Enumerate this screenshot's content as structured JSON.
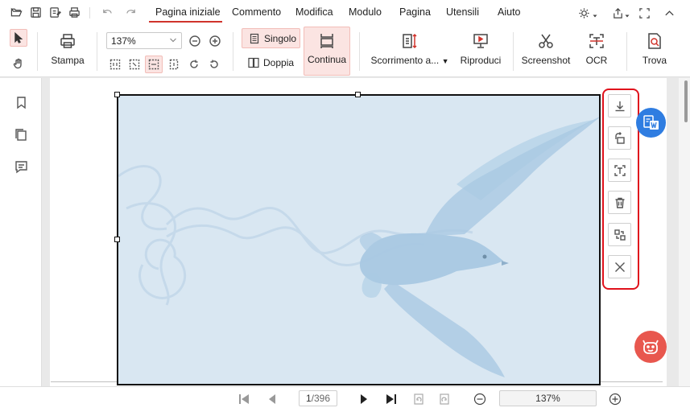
{
  "quick_access": [
    "open-icon",
    "save-icon",
    "save-as-icon",
    "print-icon",
    "undo-icon",
    "redo-icon"
  ],
  "menu": {
    "items": [
      "Pagina iniziale",
      "Commento",
      "Modifica",
      "Modulo",
      "Pagina",
      "Utensili",
      "Aiuto"
    ],
    "active": "Pagina iniziale"
  },
  "window_controls": [
    "theme-icon",
    "share-icon",
    "fullscreen-icon",
    "collapse-icon"
  ],
  "ribbon": {
    "print": "Stampa",
    "zoom_value": "137%",
    "single": "Singolo",
    "double": "Doppia",
    "continuous": "Continua",
    "scroll": "Scorrimento a...",
    "play": "Riproduci",
    "screenshot": "Screenshot",
    "ocr": "OCR",
    "find": "Trova"
  },
  "sidebar_icons": [
    "bookmark-icon",
    "pages-icon",
    "comment-icon",
    "chevron-down-icon"
  ],
  "floating_toolbar": [
    "download-icon",
    "rotate-icon",
    "text-extract-icon",
    "delete-icon",
    "replace-icon",
    "close-icon"
  ],
  "bottom_bar": {
    "page_input": "1",
    "page_total": "/396",
    "zoom": "137%"
  },
  "colors": {
    "accent": "#d0342c",
    "highlight": "#fbe4e2",
    "float_border": "#e0121c",
    "word_badge": "#2f7de1",
    "robot_badge": "#e8574e",
    "image_bg": "#d9e7f2"
  }
}
